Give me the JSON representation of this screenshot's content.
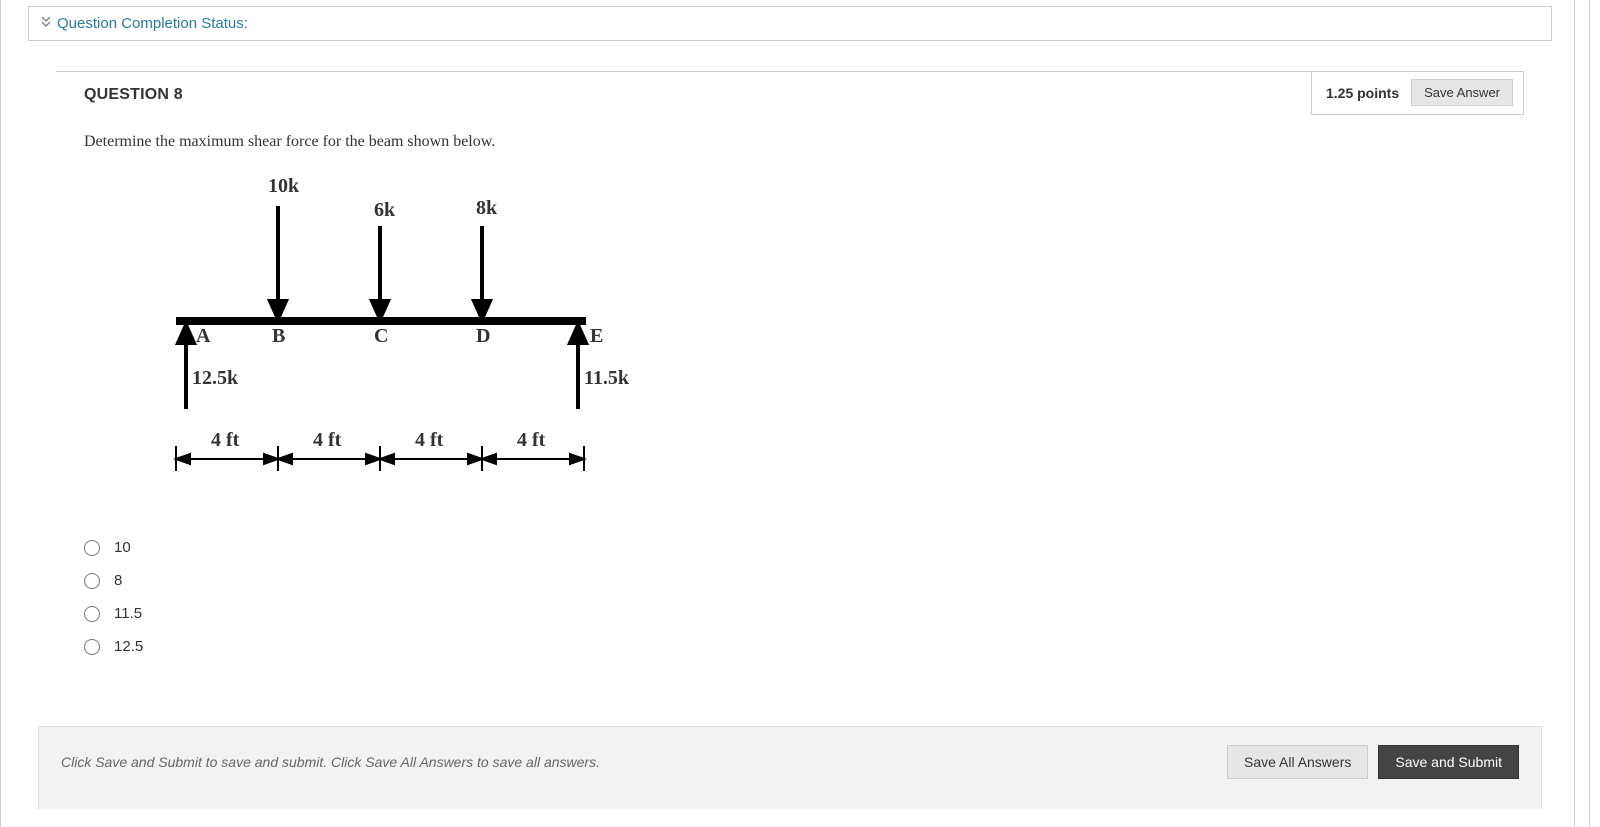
{
  "status_bar": {
    "label": "Question Completion Status:"
  },
  "question": {
    "title": "QUESTION 8",
    "points": "1.25 points",
    "save_label": "Save Answer",
    "prompt": "Determine the maximum shear force for the beam shown below."
  },
  "figure": {
    "loads": {
      "B": "10k",
      "C": "6k",
      "D": "8k"
    },
    "reactions": {
      "A": "12.5k",
      "E": "11.5k"
    },
    "nodes": [
      "A",
      "B",
      "C",
      "D",
      "E"
    ],
    "spans": [
      "4 ft",
      "4 ft",
      "4 ft",
      "4 ft"
    ]
  },
  "options": [
    "10",
    "8",
    "11.5",
    "12.5"
  ],
  "footer": {
    "hint": "Click Save and Submit to save and submit. Click Save All Answers to save all answers.",
    "save_all": "Save All Answers",
    "submit": "Save and Submit"
  }
}
